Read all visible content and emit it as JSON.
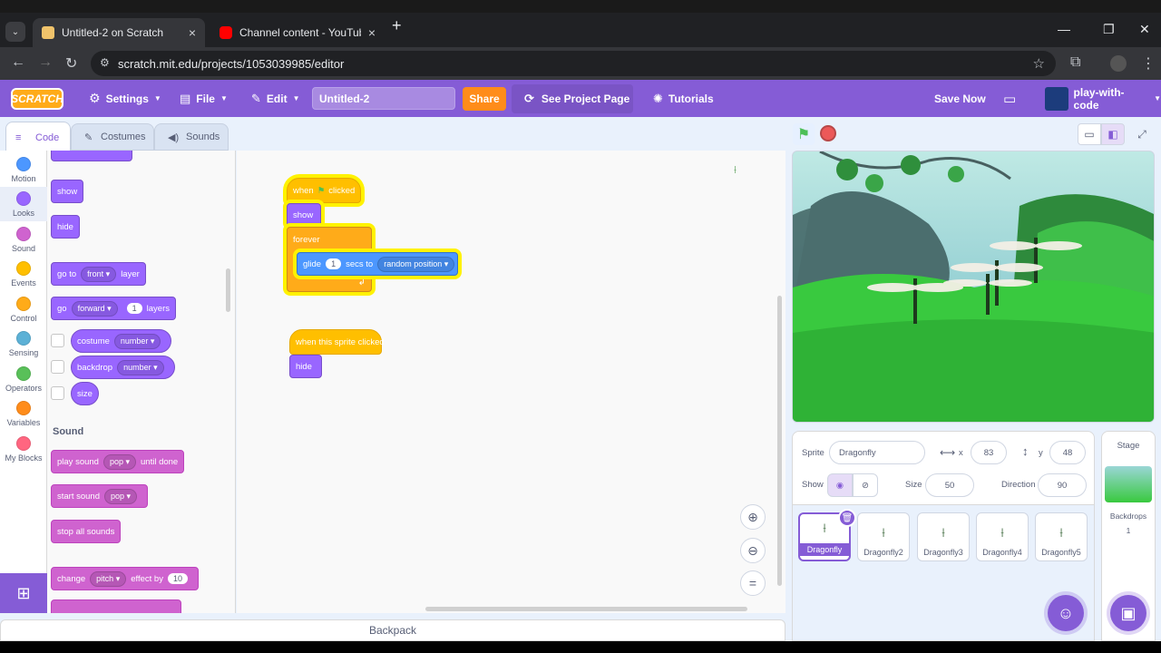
{
  "browser": {
    "tabs": [
      {
        "title": "Untitled-2 on Scratch",
        "close": "×"
      },
      {
        "title": "Channel content - YouTube Stu",
        "close": "×"
      }
    ],
    "new_tab": "+",
    "url": "scratch.mit.edu/projects/1053039985/editor"
  },
  "menubar": {
    "logo": "SCRATCH",
    "settings": "Settings",
    "file": "File",
    "edit": "Edit",
    "project_title": "Untitled-2",
    "share": "Share",
    "see_project_page": "See Project Page",
    "tutorials": "Tutorials",
    "save_now": "Save Now",
    "account": "play-with-code"
  },
  "editor_tabs": {
    "code": "Code",
    "costumes": "Costumes",
    "sounds": "Sounds"
  },
  "categories": [
    {
      "label": "Motion",
      "color": "#4c97ff"
    },
    {
      "label": "Looks",
      "color": "#9966ff"
    },
    {
      "label": "Sound",
      "color": "#cf63cf"
    },
    {
      "label": "Events",
      "color": "#ffbf00"
    },
    {
      "label": "Control",
      "color": "#ffab19"
    },
    {
      "label": "Sensing",
      "color": "#5cb1d6"
    },
    {
      "label": "Operators",
      "color": "#59c059"
    },
    {
      "label": "Variables",
      "color": "#ff8c1a"
    },
    {
      "label": "My Blocks",
      "color": "#ff6680"
    }
  ],
  "palette": {
    "show": "show",
    "hide": "hide",
    "go_to": "go to",
    "go_to_dd": "front",
    "go_to_tail": "layer",
    "go": "go",
    "go_dd": "forward",
    "go_num": "1",
    "go_tail": "layers",
    "costume": "costume",
    "costume_dd": "number",
    "backdrop": "backdrop",
    "backdrop_dd": "number",
    "size": "size",
    "sound_heading": "Sound",
    "play_sound": "play sound",
    "play_sound_dd": "pop",
    "play_sound_tail": "until done",
    "start_sound": "start sound",
    "start_sound_dd": "pop",
    "stop_all_sounds": "stop all sounds",
    "change": "change",
    "change_dd": "pitch",
    "change_mid": "effect by",
    "change_num": "10"
  },
  "scripts": {
    "when": "when",
    "clicked": "clicked",
    "show": "show",
    "forever": "forever",
    "glide": "glide",
    "glide_num": "1",
    "secs_to": "secs to",
    "glide_dd": "random position",
    "when_sprite_clicked": "when this sprite clicked",
    "hide": "hide"
  },
  "backpack": "Backpack",
  "sprite_info": {
    "sprite_label": "Sprite",
    "sprite_name": "Dragonfly",
    "x_label": "x",
    "x": "83",
    "y_label": "y",
    "y": "48",
    "show_label": "Show",
    "size_label": "Size",
    "size": "50",
    "direction_label": "Direction",
    "direction": "90"
  },
  "sprites": [
    "Dragonfly",
    "Dragonfly2",
    "Dragonfly3",
    "Dragonfly4",
    "Dragonfly5"
  ],
  "stage_panel": {
    "title": "Stage",
    "backdrops_label": "Backdrops",
    "backdrops_count": "1"
  }
}
